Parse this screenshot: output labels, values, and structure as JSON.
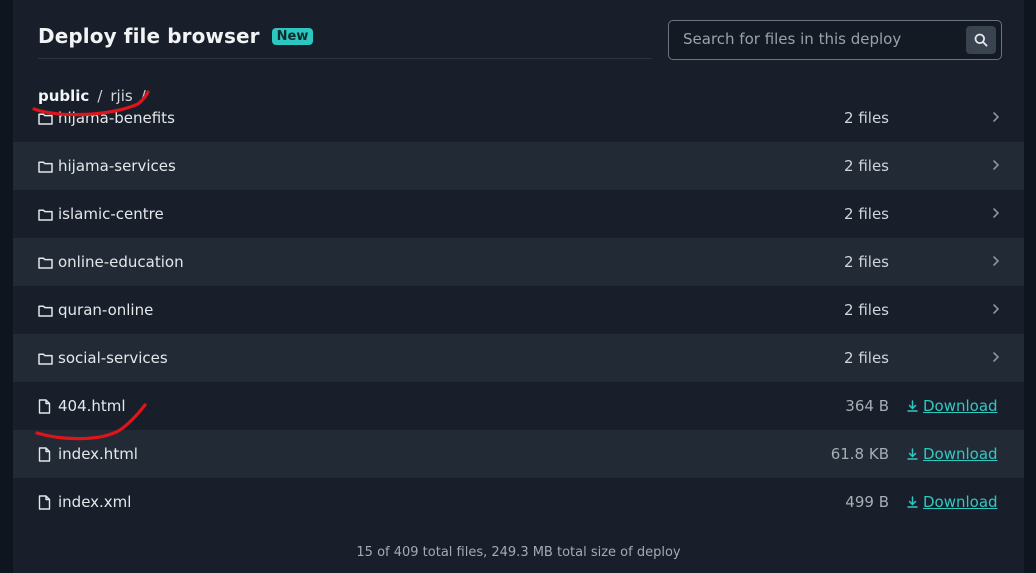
{
  "header": {
    "title": "Deploy file browser",
    "badge": "New"
  },
  "search": {
    "placeholder": "Search for files in this deploy"
  },
  "breadcrumb": {
    "root": "public",
    "folder": "rjis",
    "separator": "/"
  },
  "folders": [
    {
      "name": "hijama-benefits",
      "count": "2 files"
    },
    {
      "name": "hijama-services",
      "count": "2 files"
    },
    {
      "name": "islamic-centre",
      "count": "2 files"
    },
    {
      "name": "online-education",
      "count": "2 files"
    },
    {
      "name": "quran-online",
      "count": "2 files"
    },
    {
      "name": "social-services",
      "count": "2 files"
    }
  ],
  "files": [
    {
      "name": "404.html",
      "size": "364 B",
      "action": "Download"
    },
    {
      "name": "index.html",
      "size": "61.8 KB",
      "action": "Download"
    },
    {
      "name": "index.xml",
      "size": "499 B",
      "action": "Download"
    }
  ],
  "footer": {
    "summary": "15 of 409 total files, 249.3 MB total size of deploy"
  },
  "colors": {
    "accent": "#2bc7c0",
    "annotation": "#e0141b"
  }
}
